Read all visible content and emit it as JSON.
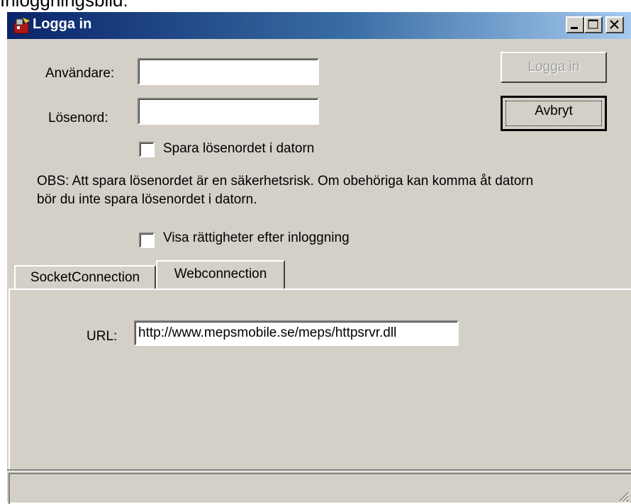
{
  "caption": "Inloggningsbild:",
  "window": {
    "title": "Logga in",
    "controls": {
      "minimize_icon": "minimize-icon",
      "maximize_icon": "maximize-icon",
      "close_icon": "close-icon"
    }
  },
  "form": {
    "username_label": "Användare:",
    "username_value": "",
    "password_label": "Lösenord:",
    "password_value": "",
    "save_password_label": "Spara lösenordet i datorn",
    "save_password_checked": false,
    "warning_line1": "OBS: Att spara lösenordet är en säkerhetsrisk. Om obehöriga kan komma åt datorn",
    "warning_line2": "bör du inte spara lösenordet i datorn.",
    "show_rights_label": "Visa rättigheter efter inloggning",
    "show_rights_checked": false
  },
  "buttons": {
    "login": "Logga in",
    "cancel": "Avbryt"
  },
  "tabs": [
    {
      "label": "SocketConnection",
      "active": false
    },
    {
      "label": "Webconnection",
      "active": true
    }
  ],
  "webconnection": {
    "url_label": "URL:",
    "url_value": "http://www.mepsmobile.se/meps/httpsrvr.dll"
  },
  "colors": {
    "face": "#d4d0c8",
    "titlebar_start": "#0a246a",
    "titlebar_end": "#a6caf0"
  }
}
